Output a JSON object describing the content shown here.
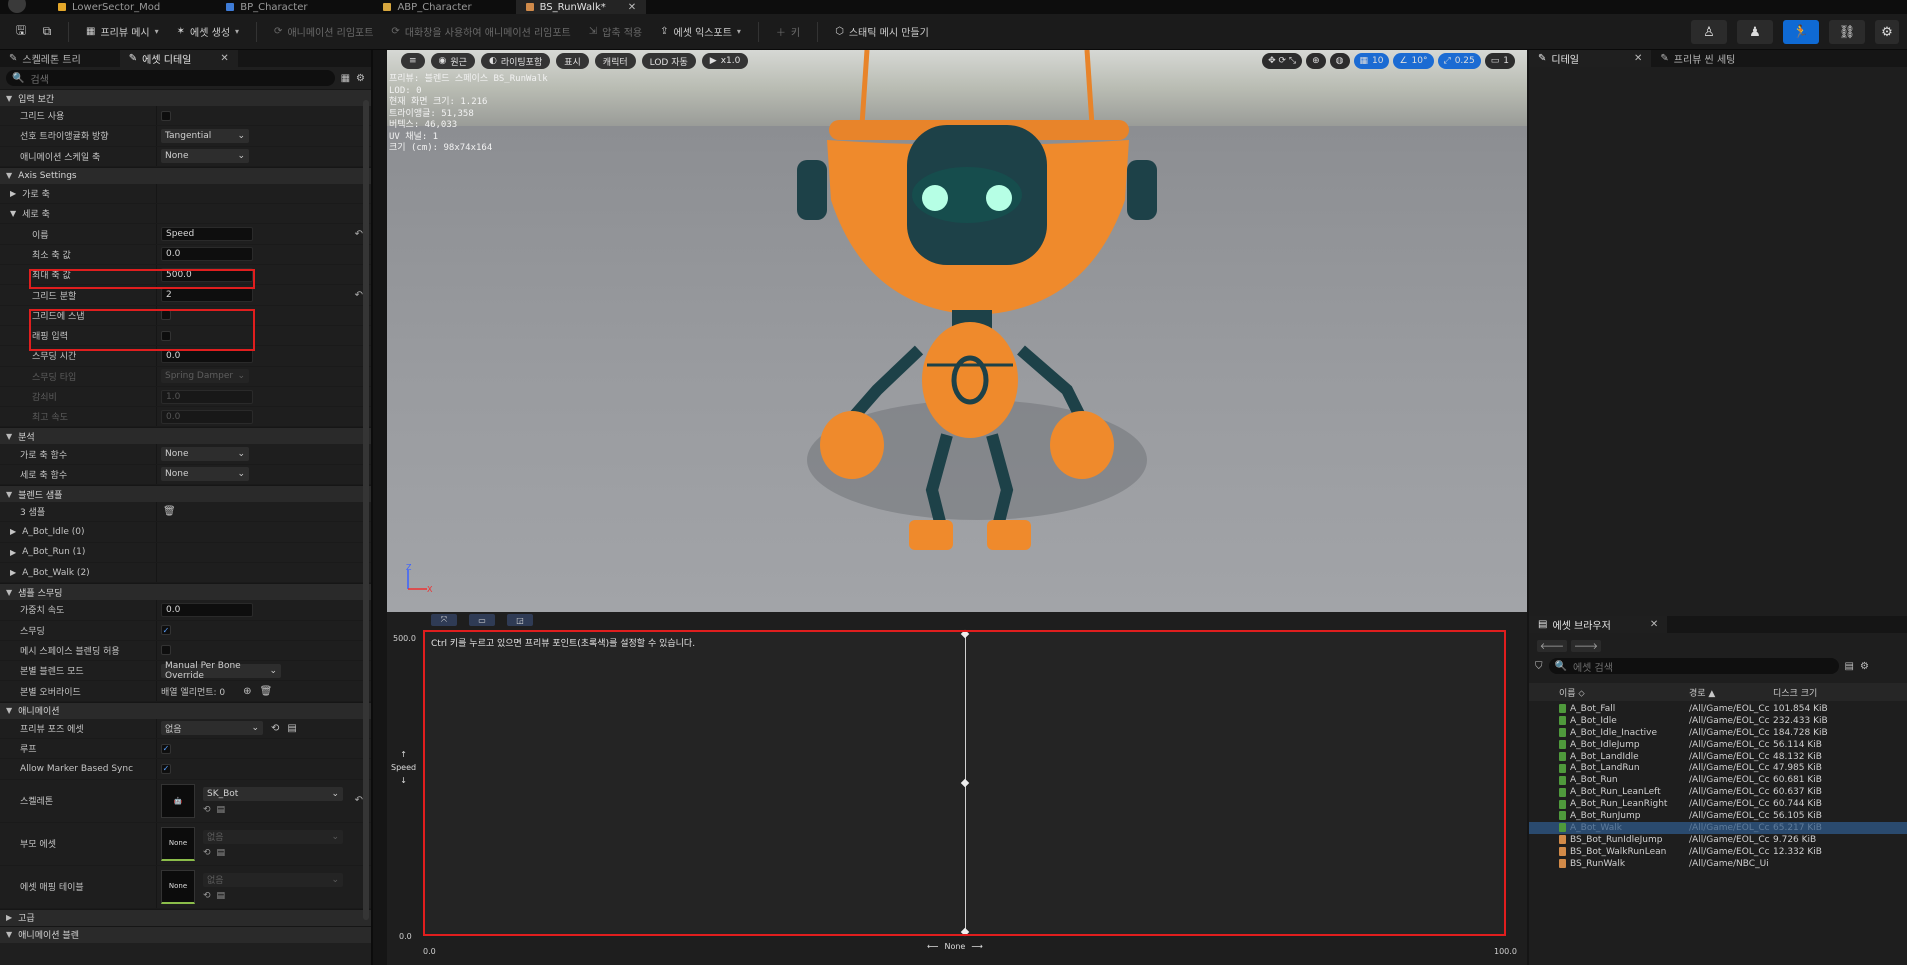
{
  "tabs": [
    {
      "label": "LowerSector_Mod",
      "color": "#e3a72a"
    },
    {
      "label": "BP_Character",
      "color": "#3e7bd6"
    },
    {
      "label": "ABP_Character",
      "color": "#d6a63e"
    },
    {
      "label": "BS_RunWalk*",
      "color": "#d08a4a"
    }
  ],
  "toolbar": {
    "preview_mesh": "프리뷰 메시",
    "create_asset": "에셋 생성",
    "reimport_anim": "애니메이션 리임포트",
    "reimport_with_source": "대화창을 사용하여 애니메이션 리임포트",
    "apply_compression": "압축 적용",
    "export_asset": "에셋 익스포트",
    "key": "키",
    "make_static_mesh": "스태틱 메시 만들기"
  },
  "left_panel": {
    "tab_skeleton_tree": "스켈레톤 트리",
    "tab_asset_details": "에셋 디테일",
    "search_placeholder": "검색",
    "sections": {
      "input_interp": "입력 보간",
      "axis_settings": "Axis Settings",
      "horizontal_axis": "가로 축",
      "vertical_axis": "세로 축",
      "analysis": "분석",
      "blend_samples": "블렌드 샘플",
      "sample_smoothing": "샘플 스무딩",
      "animation": "애니메이션",
      "advanced": "고급",
      "anim_notify": "애니메이션 블렌"
    },
    "props": {
      "grid_enable_label": "그리드 사용",
      "pref_tri_dir_label": "선호 트라이앵귤화 방향",
      "pref_tri_dir_value": "Tangential",
      "anim_skeleton_axis_label": "애니메이션 스케일 축",
      "anim_skeleton_axis_value": "None",
      "name_label": "이름",
      "name_value": "Speed",
      "min_axis_label": "최소 축 값",
      "min_axis_value": "0.0",
      "max_axis_label": "최대 축 값",
      "max_axis_value": "500.0",
      "grid_div_label": "그리드 분할",
      "grid_div_value": "2",
      "snap_grid_label": "그리드에 스냅",
      "wrap_input_label": "래핑 입력",
      "smooth_time_label": "스무딩 시간",
      "smooth_time_value": "0.0",
      "smooth_type_label": "스무딩 타입",
      "smooth_type_value": "Spring Damper",
      "damping_label": "감쇠비",
      "damping_value": "1.0",
      "max_speed_label": "최고 속도",
      "max_speed_value": "0.0",
      "h_axis_func_label": "가로 축 함수",
      "h_axis_func_value": "None",
      "v_axis_func_label": "세로 축 함수",
      "v_axis_func_value": "None",
      "samples_count": "3 샘플",
      "sample_0": "A_Bot_Idle (0)",
      "sample_1": "A_Bot_Run (1)",
      "sample_2": "A_Bot_Walk (2)",
      "weight_speed_label": "가중치 속도",
      "weight_speed_value": "0.0",
      "smoothing_label": "스무딩",
      "mesh_blend_label": "메시 스페이스 블렌딩 허용",
      "per_bone_mode_label": "본별 블렌드 모드",
      "per_bone_mode_value": "Manual Per Bone Override",
      "per_bone_override_label": "본별 오버라이드",
      "per_bone_override_value": "배열 엘리먼트: 0",
      "preview_pose_label": "프리뷰 포즈 에셋",
      "preview_pose_value": "없음",
      "loop_label": "루프",
      "allow_marker_label": "Allow Marker Based Sync",
      "skeleton_label": "스켈레톤",
      "skeleton_value": "SK_Bot",
      "parent_asset_label": "부모 에셋",
      "parent_asset_value": "없음",
      "asset_map_label": "에셋 매핑 테이블",
      "asset_map_value": "없음",
      "none_thumb": "None"
    }
  },
  "viewport": {
    "perspective": "원근",
    "lighting": "라이팅포함",
    "show": "표시",
    "character": "캐릭터",
    "lod": "LOD 자동",
    "play": "x1.0",
    "grid_snap": "10",
    "rot_snap": "10°",
    "scale_snap": "0.25",
    "cam_speed": "1",
    "stats": [
      "프리뷰: 블렌드 스페이스 BS_RunWalk",
      "LOD: 0",
      "현재 화면 크기: 1.216",
      "트라이앵글: 51,358",
      "버텍스: 46,033",
      "UV 채널: 1",
      "크기 (cm): 98x74x164"
    ]
  },
  "graph": {
    "hint": "Ctrl 키를 누르고 있으면 프리뷰 포인트(초록색)를 설정할 수 있습니다.",
    "y_max": "500.0",
    "y_min": "0.0",
    "x_min": "0.0",
    "x_max": "100.0",
    "y_axis_name": "Speed",
    "x_axis_name": "None"
  },
  "details_panel": {
    "tab_details": "디테일",
    "tab_preview_settings": "프리뷰 씬 세팅"
  },
  "browser": {
    "title": "에셋 브라우저",
    "search_placeholder": "에셋 검색",
    "col_name": "이름",
    "col_path": "경로",
    "col_size": "디스크 크기",
    "rows": [
      {
        "name": "A_Bot_Fall",
        "path": "/All/Game/EOL_Cc",
        "size": "101.854 KiB",
        "type": "anim"
      },
      {
        "name": "A_Bot_Idle",
        "path": "/All/Game/EOL_Cc",
        "size": "232.433 KiB",
        "type": "anim"
      },
      {
        "name": "A_Bot_Idle_Inactive",
        "path": "/All/Game/EOL_Cc",
        "size": "184.728 KiB",
        "type": "anim"
      },
      {
        "name": "A_Bot_IdleJump",
        "path": "/All/Game/EOL_Cc",
        "size": "56.114 KiB",
        "type": "anim"
      },
      {
        "name": "A_Bot_LandIdle",
        "path": "/All/Game/EOL_Cc",
        "size": "48.132 KiB",
        "type": "anim"
      },
      {
        "name": "A_Bot_LandRun",
        "path": "/All/Game/EOL_Cc",
        "size": "47.985 KiB",
        "type": "anim"
      },
      {
        "name": "A_Bot_Run",
        "path": "/All/Game/EOL_Cc",
        "size": "60.681 KiB",
        "type": "anim"
      },
      {
        "name": "A_Bot_Run_LeanLeft",
        "path": "/All/Game/EOL_Cc",
        "size": "60.637 KiB",
        "type": "anim"
      },
      {
        "name": "A_Bot_Run_LeanRight",
        "path": "/All/Game/EOL_Cc",
        "size": "60.744 KiB",
        "type": "anim"
      },
      {
        "name": "A_Bot_RunJump",
        "path": "/All/Game/EOL_Cc",
        "size": "56.105 KiB",
        "type": "anim"
      },
      {
        "name": "A_Bot_Walk",
        "path": "/All/Game/EOL_Cc",
        "size": "65.217 KiB",
        "type": "anim",
        "selected": true
      },
      {
        "name": "BS_Bot_RunIdleJump",
        "path": "/All/Game/EOL_Cc",
        "size": "9.726 KiB",
        "type": "bs"
      },
      {
        "name": "BS_Bot_WalkRunLean",
        "path": "/All/Game/EOL_Cc",
        "size": "12.332 KiB",
        "type": "bs"
      },
      {
        "name": "BS_RunWalk",
        "path": "/All/Game/NBC_Ui",
        "size": "",
        "type": "bs"
      }
    ]
  }
}
